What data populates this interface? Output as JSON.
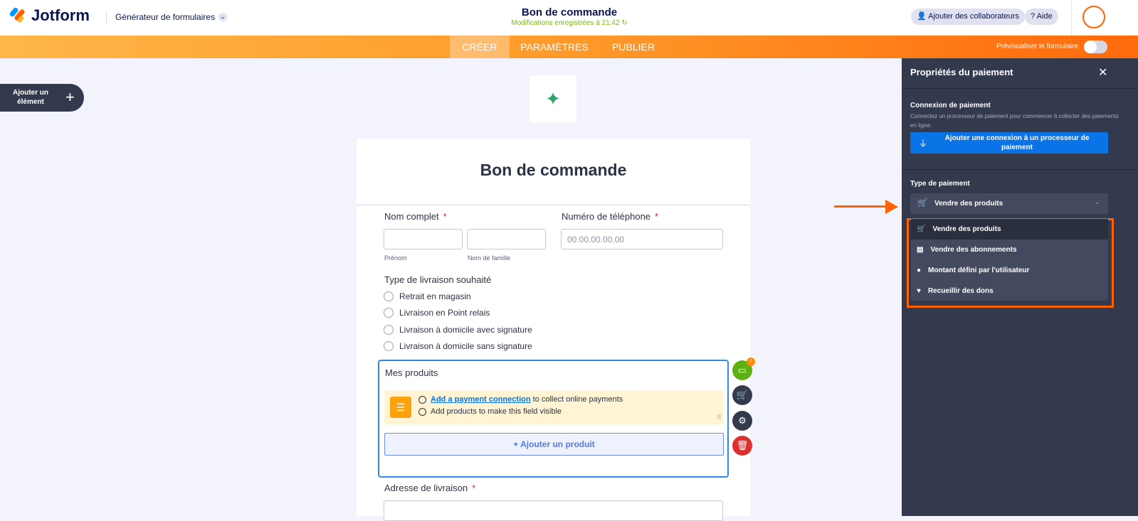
{
  "header": {
    "brand": "Jotform",
    "builder": "Générateur de formulaires",
    "form_title": "Bon de commande",
    "save_status": "Modifications enregistrées à 21:42",
    "collab": "Ajouter des collaborateurs",
    "help": "Aide"
  },
  "nav": {
    "tabs": [
      "CRÉER",
      "PARAMÈTRES",
      "PUBLIER"
    ],
    "active": "CRÉER",
    "preview": "Prévisualiser le formulaire"
  },
  "add_element": {
    "line1": "Ajouter un",
    "line2": "élément"
  },
  "form": {
    "title": "Bon de commande",
    "name_label": "Nom complet",
    "first": "Prénom",
    "last": "Nom de famille",
    "phone_label": "Numéro de téléphone",
    "phone_placeholder": "00.00.00.00.00",
    "delivery_label": "Type de livraison souhaité",
    "delivery_options": [
      "Retrait en magasin",
      "Livraison en Point relais",
      "Livraison à domicile avec signature",
      "Livraison à domicile sans signature"
    ],
    "products_label": "Mes produits",
    "notice_link": "Add a payment connection",
    "notice_rest": " to collect online payments",
    "notice2": "Add products to make this field visible",
    "add_product": "+ Ajouter un produit",
    "address_label": "Adresse de livraison",
    "required": "*",
    "badge": "!"
  },
  "panel": {
    "title": "Propriétés du paiement",
    "conn_title": "Connexion de paiement",
    "conn_desc": "Connectez un processeur de paiement pour commencer à collecter des paiements en ligne.",
    "conn_button": "Ajouter une connexion à un processeur de paiement",
    "type_label": "Type de paiement",
    "selected": "Vendre des produits",
    "options": [
      "Vendre des produits",
      "Vendre des abonnements",
      "Montant défini par l'utilisateur",
      "Recueillir des dons"
    ]
  },
  "colors": {
    "orange": "#ff6100",
    "panel": "#343a4e",
    "blue": "#0a74e6"
  }
}
